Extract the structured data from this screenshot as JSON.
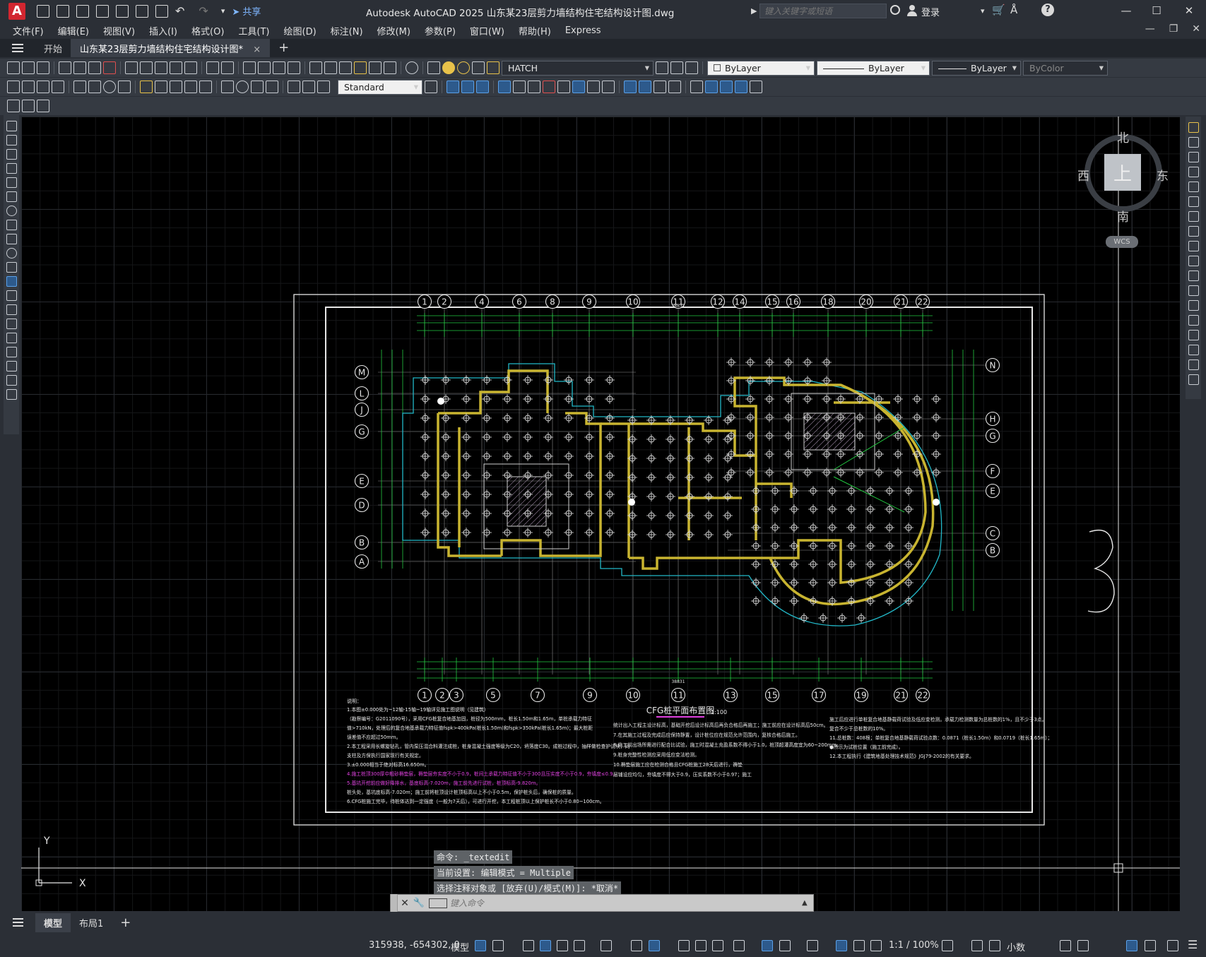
{
  "titlebar": {
    "app_logo": "A",
    "share_label": "共享",
    "title": "Autodesk AutoCAD 2025    山东某23层剪力墙结构住宅结构设计图.dwg",
    "search_placeholder": "键入关键字或短语",
    "login_label": "登录"
  },
  "menu": [
    "文件(F)",
    "编辑(E)",
    "视图(V)",
    "插入(I)",
    "格式(O)",
    "工具(T)",
    "绘图(D)",
    "标注(N)",
    "修改(M)",
    "参数(P)",
    "窗口(W)",
    "帮助(H)",
    "Express"
  ],
  "doc_tabs": {
    "start": "开始",
    "active": "山东某23层剪力墙结构住宅结构设计图*",
    "close": "×",
    "new": "+"
  },
  "toolbar": {
    "layer_name": "HATCH",
    "color": "ByLayer",
    "linetype": "ByLayer",
    "lineweight": "ByLayer",
    "plotstyle": "ByColor",
    "text_style": "Standard"
  },
  "drawing": {
    "top_axes": [
      "1",
      "2",
      "4",
      "6",
      "8",
      "9",
      "10",
      "11",
      "12",
      "14",
      "15",
      "16",
      "18",
      "20",
      "21",
      "22"
    ],
    "bottom_axes": [
      "1",
      "2",
      "3",
      "5",
      "7",
      "9",
      "10",
      "11",
      "13",
      "15",
      "17",
      "19",
      "21",
      "22"
    ],
    "left_axes": [
      "M",
      "L",
      "J",
      "G",
      "E",
      "D",
      "B",
      "A"
    ],
    "right_axes": [
      "N",
      "H",
      "G",
      "F",
      "E",
      "C",
      "B"
    ],
    "plan_title": "CFG桩平面布置图",
    "plan_scale": "1:100",
    "overall_dim": "38831",
    "notes_heading": "说明：",
    "notes_left": [
      "1.本图±0.000处为~12轴-15轴~19轴详见施工图说明（见建筑）",
      "（勘察编号：G2011090号），采用CFG桩复合地基加固，桩径为500mm，桩长1.50m和1.65m，单桩承载力特征",
      "值>710kN，处理后的复合地基承载力特征值fspk>400kPa(桩长1.50m)和fspk>350kPa(桩长1.65m)；最大桩距",
      "误差值不应超过50mm。",
      "2.本工程采用长螺旋钻孔，管内泵压混合料灌注成桩，桩身混凝土强度等级为C20，坍落度C30。成桩过程中，抽样做检查护试块，同",
      "  支柱及方保执行国家现行有关规定。",
      "3.±0.000相当于绝对标高16.650m。",
      "4.施工桩顶300厚中粗砂褥垫层，褥垫层夯实度不小于0.9，桩间土承载力特征值不小于300且压实度不小于0.9，夯填度≤0.9。",
      "5.基坑开挖前应做好降排水，基底标高-7.020m，施工前先进行试桩，桩顶标高-9.820m。",
      "  桩头处，基坑底标高-7.020m；施工前将桩顶设计桩顶标高以上不小于0.5m，保护桩头后，确保桩的质量。",
      "6.CFG桩施工完毕，待桩体达到一定强度（一般为7天后），可进行开挖，本工程桩顶以上保护桩长不小于0.80~100cm。"
    ],
    "notes_mid": [
      "统计出入工程主设计标高，基础开挖后设计标高后再负合格后再施工；施工前应在设计标高后50cm。",
      "7.在其施工过程及完成后应保持静置，设计桩位应在规范允许范围内，复核合格后施工。",
      "8.施工前出场所需进行配合比试验，施工时混凝土充盈系数不得小于1.0，桩顶超灌高度宜为60~200mm。",
      "9.桩身完整性检测应采用低应变法检测。",
      "10.褥垫层施工应在检测合格且CFG桩施工28天后进行，褥垫",
      "  层铺设应均匀，夯填度不得大于0.9，压实系数不小于0.97；施工"
    ],
    "notes_right": [
      "施工后应进行单桩复合地基静载荷试验及低应变检测。承载力检测数量为总桩数的1%，且不少于3点。",
      "复合不少于总桩数的10%。",
      "11.总桩数：408根；单桩复合地基静载荷试验点数：0.0871（桩长1.50m）和0.0719（桩长1.65m）；",
      "  ●所示为试桩位置（施工前完成）。",
      "12.本工程执行《建筑地基处理技术规范》JGJ79-2002的有关要求。"
    ]
  },
  "viewcube": {
    "north": "北",
    "south": "南",
    "east": "东",
    "west": "西",
    "face": "上",
    "wcs": "WCS"
  },
  "ucs": {
    "x": "X",
    "y": "Y"
  },
  "command": {
    "history": [
      "命令:  _textedit",
      "当前设置: 编辑模式 = Multiple",
      "选择注释对象或 [放弃(U)/模式(M)]: *取消*"
    ],
    "placeholder": "键入命令"
  },
  "layout_tabs": {
    "model": "模型",
    "layout1": "布局1",
    "add": "+"
  },
  "status": {
    "coords": "315938, -654302, 0",
    "model": "模型",
    "scale": "1:1 / 100%",
    "units": "小数"
  }
}
